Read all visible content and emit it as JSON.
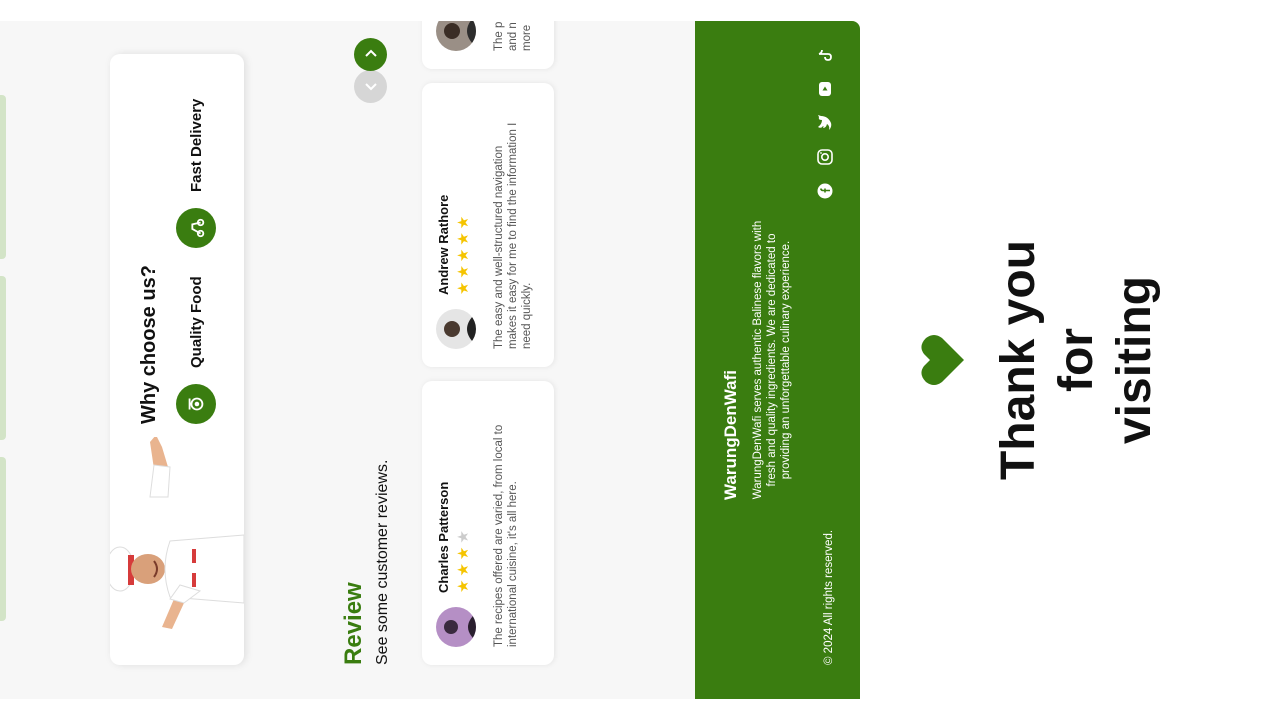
{
  "why_choose": {
    "title": "Why choose us?",
    "features": [
      {
        "label": "Quality Food",
        "icon": "food-icon"
      },
      {
        "label": "Fast Delivery",
        "icon": "delivery-icon"
      }
    ]
  },
  "carousel": {
    "prev_icon": "chevron-up-icon",
    "next_icon": "chevron-down-icon"
  },
  "review": {
    "title": "Review",
    "subtitle": "See some customer reviews.",
    "cards": [
      {
        "name": "Charles Patterson",
        "rating": 3,
        "text": "The recipes offered are varied, from local to international cuisine, it's all here."
      },
      {
        "name": "Andrew Rathore",
        "rating": 5,
        "text": "The easy and well-structured navigation makes it easy for me to find the information I need quickly."
      },
      {
        "name": "",
        "rating": 0,
        "text": "The p and n more"
      }
    ]
  },
  "footer": {
    "brand": "WarungDenWafi",
    "description": "WarungDenWafi serves authentic Balinese flavors with fresh and quality ingredients. We are dedicated to providing an unforgettable culinary experience.",
    "copyright": "© 2024 All rights reserved.",
    "socials": [
      "facebook-icon",
      "instagram-icon",
      "twitter-icon",
      "youtube-icon",
      "tiktok-icon"
    ]
  },
  "thanks": {
    "line1": "Thank you for",
    "line2": "visiting"
  },
  "colors": {
    "brand_green": "#3a7d10",
    "star": "#f5c400",
    "muted": "#d3e4c7"
  }
}
